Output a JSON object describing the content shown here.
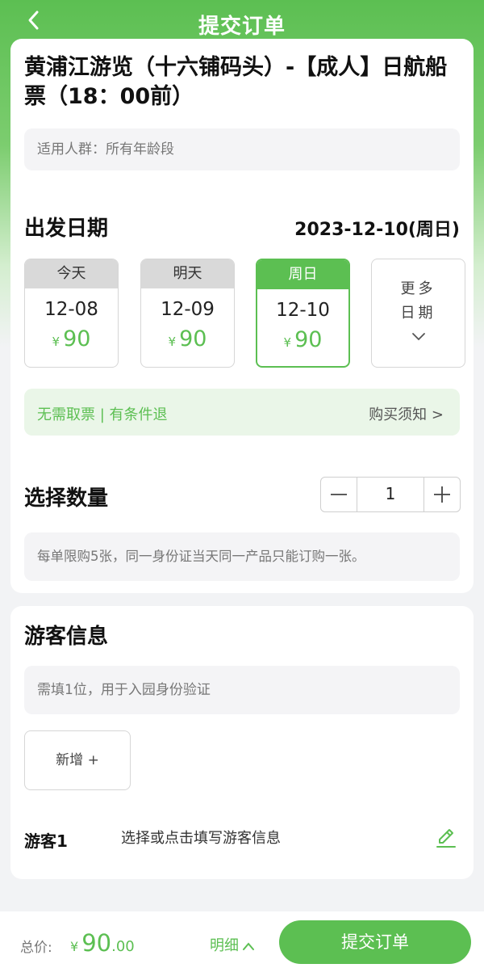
{
  "header": {
    "title": "提交订单"
  },
  "product": {
    "title": "黄浦江游览（十六铺码头）-【成人】日航船票（18：00前）",
    "suitable": "适用人群：所有年龄段"
  },
  "departure": {
    "title": "出发日期",
    "selected_date": "2023-12-10(周日)",
    "options": [
      {
        "day": "今天",
        "date": "12-08",
        "currency": "¥",
        "price": "90"
      },
      {
        "day": "明天",
        "date": "12-09",
        "currency": "¥",
        "price": "90"
      },
      {
        "day": "周日",
        "date": "12-10",
        "currency": "¥",
        "price": "90"
      }
    ],
    "more_line1": "更多",
    "more_line2": "日期"
  },
  "notice": {
    "left": "无需取票 | 有条件退",
    "right": "购买须知 >"
  },
  "quantity": {
    "title": "选择数量",
    "value": "1",
    "limit_note": "每单限购5张，同一身份证当天同一产品只能订购一张。"
  },
  "visitors": {
    "title": "游客信息",
    "note": "需填1位，用于入园身份验证",
    "add_label": "新增 +",
    "items": [
      {
        "label": "游客1",
        "hint": "选择或点击填写游客信息"
      }
    ]
  },
  "footer": {
    "total_label": "总价:",
    "currency": "¥",
    "total_int": "90",
    "total_dec": ".00",
    "detail_label": "明细",
    "submit_label": "提交订单"
  },
  "colors": {
    "accent": "#5cbf52",
    "selected_day_bg": "#5cbf52",
    "notice_bg": "#eaf6e8"
  }
}
